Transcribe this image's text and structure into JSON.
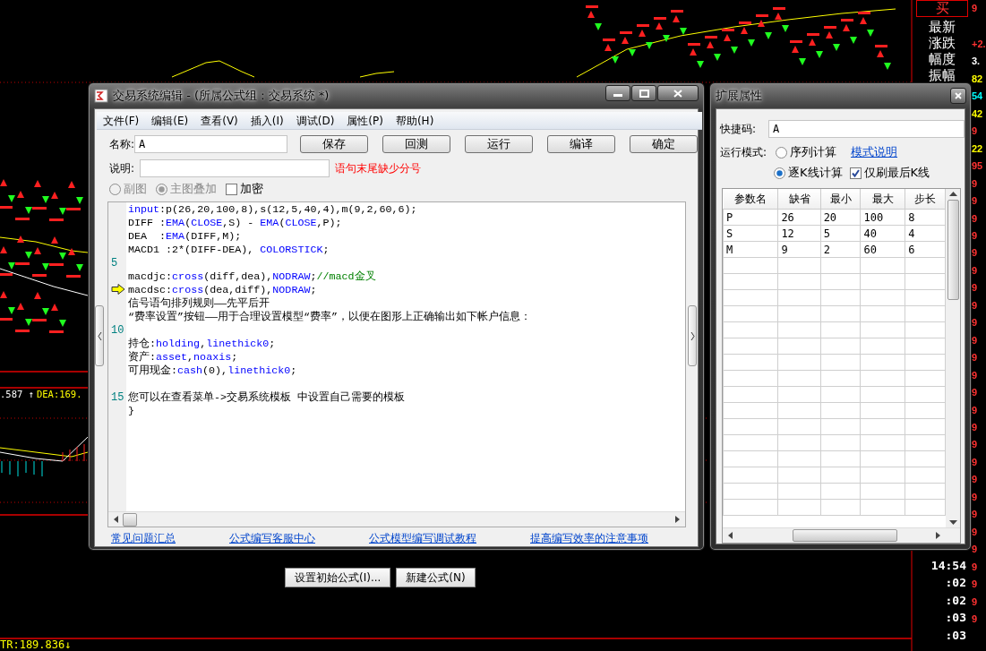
{
  "chart": {
    "readouts": [
      {
        "text": ".587 ↑",
        "color": "#ffffff"
      },
      {
        "text": "DEA:169.",
        "color": "#ffff00"
      }
    ],
    "bottom_readout": "TR:189.836↓"
  },
  "quote_panel": {
    "header": "买",
    "header_value": "9",
    "labels": [
      "最新",
      "涨跌",
      "幅度",
      "振幅"
    ],
    "values": [
      {
        "text": "+2.",
        "color": "#ff3232"
      },
      {
        "text": "3.",
        "color": "#ffffff"
      },
      {
        "text": "82",
        "color": "#ffff00"
      },
      {
        "text": "54",
        "color": "#00ffff"
      },
      {
        "text": "42",
        "color": "#ffff00"
      },
      {
        "text": "9",
        "color": "#ff3232"
      },
      {
        "text": "22",
        "color": "#ffff00"
      },
      {
        "text": "95",
        "color": "#ff3232"
      },
      {
        "text": "9",
        "color": "#ff3232"
      },
      {
        "text": "9",
        "color": "#ff3232"
      },
      {
        "text": "9",
        "color": "#ff3232"
      },
      {
        "text": "9",
        "color": "#ff3232"
      },
      {
        "text": "9",
        "color": "#ff3232"
      },
      {
        "text": "9",
        "color": "#ff3232"
      },
      {
        "text": "9",
        "color": "#ff3232"
      },
      {
        "text": "9",
        "color": "#ff3232"
      },
      {
        "text": "9",
        "color": "#ff3232"
      },
      {
        "text": "9",
        "color": "#ff3232"
      },
      {
        "text": "9",
        "color": "#ff3232"
      },
      {
        "text": "9",
        "color": "#ff3232"
      },
      {
        "text": "9",
        "color": "#ff3232"
      },
      {
        "text": "9",
        "color": "#ff3232"
      },
      {
        "text": "9",
        "color": "#ff3232"
      },
      {
        "text": "9",
        "color": "#ff3232"
      },
      {
        "text": "9",
        "color": "#ff3232"
      },
      {
        "text": "9",
        "color": "#ff3232"
      },
      {
        "text": "9",
        "color": "#ff3232"
      },
      {
        "text": "9",
        "color": "#ff3232"
      },
      {
        "text": "9",
        "color": "#ff3232"
      },
      {
        "text": "9",
        "color": "#ff3232"
      },
      {
        "text": "9",
        "color": "#ff3232"
      },
      {
        "text": "9",
        "color": "#ff3232"
      },
      {
        "text": "9",
        "color": "#ff3232"
      },
      {
        "text": "9",
        "color": "#ff3232"
      }
    ],
    "times": [
      "14:54",
      ":02",
      ":02",
      ":03",
      ":03"
    ]
  },
  "editor": {
    "title": "交易系统编辑 - (所属公式组 : 交易系统 *)",
    "menu": [
      "文件(F)",
      "编辑(E)",
      "查看(V)",
      "插入(I)",
      "调试(D)",
      "属性(P)",
      "帮助(H)"
    ],
    "name_label": "名称:",
    "name_value": "A",
    "desc_label": "说明:",
    "error": "语句末尾缺少分号",
    "buttons": [
      "保存",
      "回测",
      "运行",
      "编译",
      "确定"
    ],
    "options": [
      {
        "kind": "radio",
        "label": "副图",
        "checked": false,
        "disabled": true
      },
      {
        "kind": "radio",
        "label": "主图叠加",
        "checked": true,
        "disabled": true
      },
      {
        "kind": "checkbox",
        "label": "加密",
        "checked": false,
        "disabled": false
      }
    ],
    "code_lines": [
      {
        "pointer": false,
        "parts": [
          {
            "kind": "keyword",
            "text": "input"
          },
          {
            "kind": "plain",
            "text": ":p(26,20,100,8),s(12,5,40,4),m(9,2,60,6);"
          }
        ]
      },
      {
        "pointer": false,
        "parts": [
          {
            "kind": "plain",
            "text": "DIFF :"
          },
          {
            "kind": "keyword",
            "text": "EMA"
          },
          {
            "kind": "plain",
            "text": "("
          },
          {
            "kind": "keyword",
            "text": "CLOSE"
          },
          {
            "kind": "plain",
            "text": ",S) - "
          },
          {
            "kind": "keyword",
            "text": "EMA"
          },
          {
            "kind": "plain",
            "text": "("
          },
          {
            "kind": "keyword",
            "text": "CLOSE"
          },
          {
            "kind": "plain",
            "text": ",P);"
          }
        ]
      },
      {
        "pointer": false,
        "parts": [
          {
            "kind": "plain",
            "text": "DEA  :"
          },
          {
            "kind": "keyword",
            "text": "EMA"
          },
          {
            "kind": "plain",
            "text": "(DIFF,M);"
          }
        ]
      },
      {
        "pointer": false,
        "parts": [
          {
            "kind": "plain",
            "text": "MACD1 :2*(DIFF-DEA), "
          },
          {
            "kind": "keyword",
            "text": "COLORSTICK"
          },
          {
            "kind": "plain",
            "text": ";"
          }
        ]
      },
      {
        "pointer": false,
        "number": "5"
      },
      {
        "pointer": false,
        "parts": [
          {
            "kind": "plain",
            "text": "macdjc:"
          },
          {
            "kind": "keyword",
            "text": "cross"
          },
          {
            "kind": "plain",
            "text": "(diff,dea),"
          },
          {
            "kind": "keyword",
            "text": "NODRAW"
          },
          {
            "kind": "plain",
            "text": ";"
          },
          {
            "kind": "comment",
            "text": "//macd金叉"
          }
        ]
      },
      {
        "pointer": true,
        "parts": [
          {
            "kind": "plain",
            "text": "macdsc:"
          },
          {
            "kind": "keyword",
            "text": "cross"
          },
          {
            "kind": "plain",
            "text": "(dea,diff),"
          },
          {
            "kind": "keyword",
            "text": "NODRAW"
          },
          {
            "kind": "plain",
            "text": ";"
          }
        ]
      },
      {
        "pointer": false,
        "parts": [
          {
            "kind": "plain",
            "text": "信号语句排列规则——先平后开"
          }
        ]
      },
      {
        "pointer": false,
        "parts": [
          {
            "kind": "plain",
            "text": "“费率设置”按钮——用于合理设置模型“费率”，以便在图形上正确输出如下帐户信息："
          }
        ]
      },
      {
        "pointer": false,
        "number": "10"
      },
      {
        "pointer": false,
        "parts": [
          {
            "kind": "plain",
            "text": "持仓:"
          },
          {
            "kind": "keyword",
            "text": "holding"
          },
          {
            "kind": "plain",
            "text": ","
          },
          {
            "kind": "keyword",
            "text": "linethick0"
          },
          {
            "kind": "plain",
            "text": ";"
          }
        ]
      },
      {
        "pointer": false,
        "parts": [
          {
            "kind": "plain",
            "text": "资产:"
          },
          {
            "kind": "keyword",
            "text": "asset"
          },
          {
            "kind": "plain",
            "text": ","
          },
          {
            "kind": "keyword",
            "text": "noaxis"
          },
          {
            "kind": "plain",
            "text": ";"
          }
        ]
      },
      {
        "pointer": false,
        "parts": [
          {
            "kind": "plain",
            "text": "可用现金:"
          },
          {
            "kind": "keyword",
            "text": "cash"
          },
          {
            "kind": "plain",
            "text": "(0),"
          },
          {
            "kind": "keyword",
            "text": "linethick0"
          },
          {
            "kind": "plain",
            "text": ";"
          }
        ]
      },
      {
        "pointer": false
      },
      {
        "pointer": false,
        "number": "15",
        "parts": [
          {
            "kind": "plain",
            "text": "您可以在查看菜单->交易系统模板 中设置自己需要的模板"
          }
        ]
      },
      {
        "pointer": false,
        "parts": [
          {
            "kind": "plain",
            "text": "}"
          }
        ]
      }
    ],
    "links": [
      "常见问题汇总",
      "公式编写客服中心",
      "公式模型编写调试教程",
      "提高编写效率的注意事项"
    ]
  },
  "footer_buttons": [
    "设置初始公式(I)...",
    "新建公式(N)"
  ],
  "properties": {
    "title": "扩展属性",
    "shortcut_label": "快捷码:",
    "shortcut_value": "A",
    "mode_label": "运行模式:",
    "modes": [
      {
        "label": "序列计算",
        "selected": false
      },
      {
        "label": "逐K线计算",
        "selected": true
      }
    ],
    "mode_help": "模式说明",
    "last_bar": {
      "label": "仅刷最后K线",
      "checked": true
    },
    "table": {
      "columns": [
        "参数名",
        "缺省",
        "最小",
        "最大",
        "步长"
      ],
      "rows": [
        [
          "P",
          "26",
          "20",
          "100",
          "8"
        ],
        [
          "S",
          "12",
          "5",
          "40",
          "4"
        ],
        [
          "M",
          "9",
          "2",
          "60",
          "6"
        ]
      ]
    }
  }
}
